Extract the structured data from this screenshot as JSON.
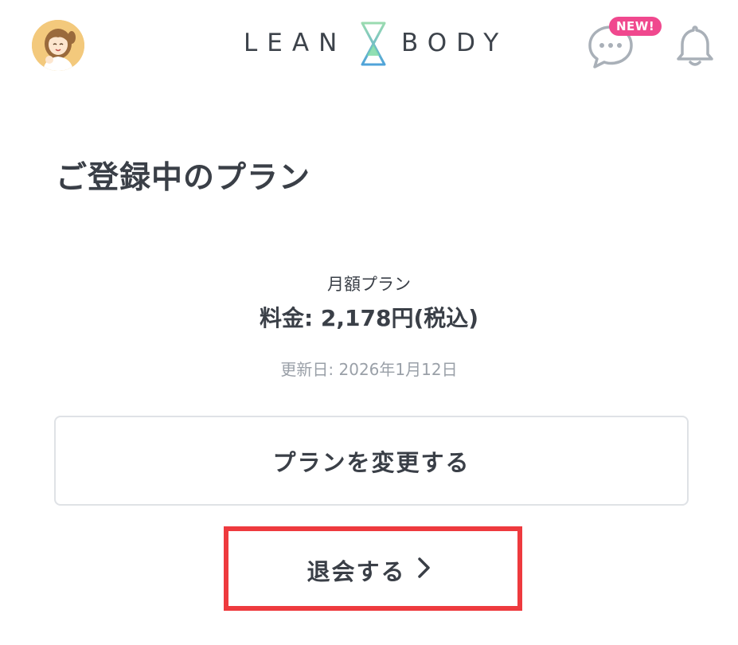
{
  "header": {
    "logo_left": "LEAN",
    "logo_right": "BODY",
    "new_badge": "NEW!",
    "icons": {
      "avatar": "user-avatar",
      "chat": "chat-bubble-icon",
      "bell": "bell-icon"
    }
  },
  "main": {
    "title": "ご登録中のプラン",
    "plan": {
      "name": "月額プラン",
      "price": "料金: 2,178円(税込)",
      "renewal": "更新日: 2026年1月12日"
    },
    "change_plan_label": "プランを変更する",
    "withdraw_label": "退会する"
  },
  "colors": {
    "text": "#3a3f47",
    "muted": "#9aa0a8",
    "badge": "#f0488e",
    "highlight": "#ee3a3e",
    "logo_mark_green": "#7ed9a6",
    "logo_mark_blue": "#4fa3d9"
  }
}
